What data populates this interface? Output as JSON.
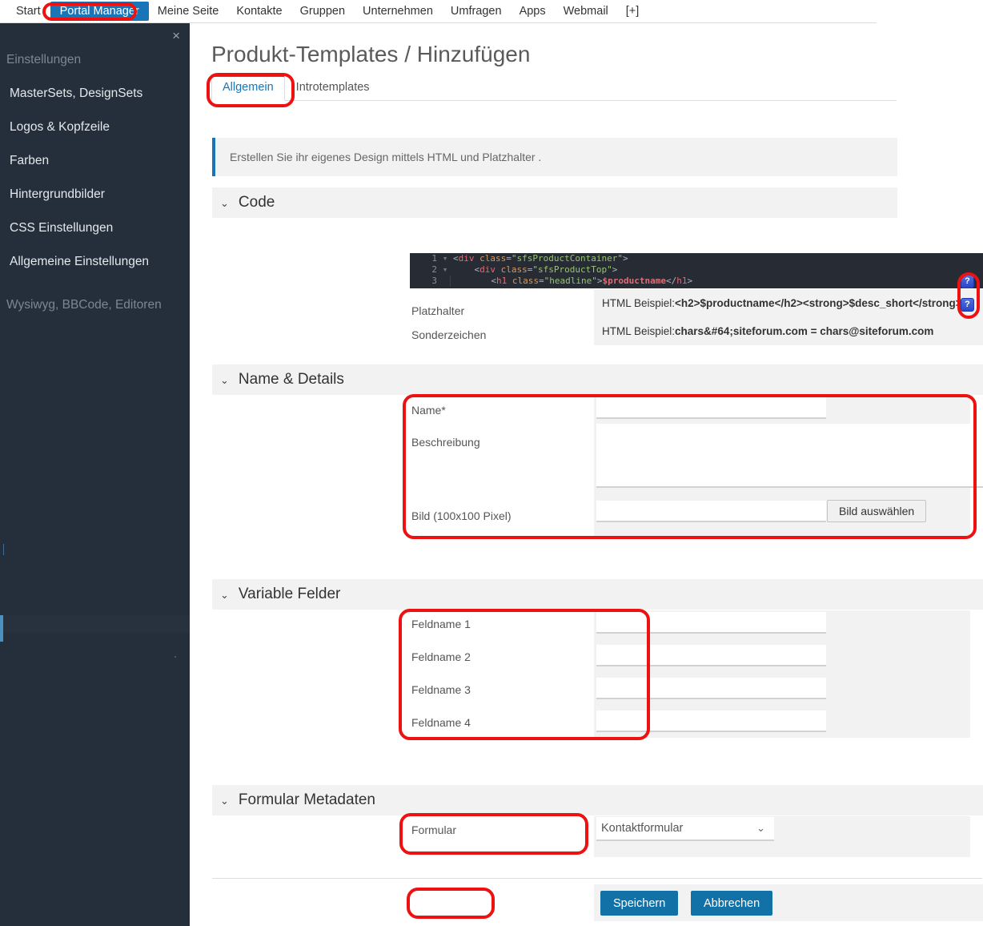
{
  "topnav": {
    "items": [
      {
        "label": "Start",
        "active": false
      },
      {
        "label": "Portal Manager",
        "active": true
      },
      {
        "label": "Meine Seite",
        "active": false
      },
      {
        "label": "Kontakte",
        "active": false
      },
      {
        "label": "Gruppen",
        "active": false
      },
      {
        "label": "Unternehmen",
        "active": false
      },
      {
        "label": "Umfragen",
        "active": false
      },
      {
        "label": "Apps",
        "active": false
      },
      {
        "label": "Webmail",
        "active": false
      },
      {
        "label": "[+]",
        "active": false
      }
    ],
    "active_bg": "#1876b8"
  },
  "sidebar": {
    "close_icon": "×",
    "group_title": "Einstellungen",
    "items": [
      {
        "label": "MasterSets, DesignSets"
      },
      {
        "label": "Logos & Kopfzeile"
      },
      {
        "label": "Farben"
      },
      {
        "label": "Hintergrundbilder"
      },
      {
        "label": "CSS Einstellungen"
      },
      {
        "label": "Allgemeine Einstellungen"
      }
    ],
    "group_title_2": "Wysiwyg, BBCode, Editoren",
    "bg": "#242f3b",
    "accent": "#4a90c2"
  },
  "page": {
    "title": "Produkt-Templates / Hinzufügen"
  },
  "tabs": [
    {
      "label": "Allgemein",
      "active": true
    },
    {
      "label": "Introtemplates",
      "active": false
    }
  ],
  "info_banner": {
    "text": "Erstellen Sie ihr eigenes Design mittels HTML und Platzhalter .",
    "accent": "#1876b8"
  },
  "sections": {
    "code": {
      "title": "Code",
      "chevron": "⌄"
    },
    "name_details": {
      "title": "Name & Details",
      "chevron": "⌄"
    },
    "variable_felder": {
      "title": "Variable Felder",
      "chevron": "⌄"
    },
    "formular_metadaten": {
      "title": "Formular Metadaten",
      "chevron": "⌄"
    }
  },
  "code_editor": {
    "lines": [
      {
        "number": "1",
        "fold": "▾",
        "text": "<div class=\"sfsProductContainer\">"
      },
      {
        "number": "2",
        "fold": "▾",
        "text": "    <div class=\"sfsProductTop\">"
      },
      {
        "number": "3",
        "fold": "",
        "text": "        <h1 class=\"headline\">$productname</h1>"
      }
    ]
  },
  "placeholders": {
    "rows": [
      {
        "label": "Platzhalter",
        "lead": "HTML Beispiel: ",
        "code": "<h2>$productname</h2><strong>$desc_short</strong>",
        "help_icon": "?"
      },
      {
        "label": "Sonderzeichen",
        "lead": "HTML Beispiel: ",
        "code": "chars&#64;siteforum.com = chars@siteforum.com",
        "help_icon": "?"
      }
    ]
  },
  "name_details": {
    "name": {
      "label": "Name*",
      "value": "",
      "placeholder": ""
    },
    "beschreibung": {
      "label": "Beschreibung",
      "value": "",
      "placeholder": ""
    },
    "bild": {
      "label": "Bild (100x100 Pixel)",
      "value": "",
      "placeholder": "",
      "button_label": "Bild auswählen"
    }
  },
  "variable_felder": {
    "fields": [
      {
        "label": "Feldname 1",
        "value": ""
      },
      {
        "label": "Feldname 2",
        "value": ""
      },
      {
        "label": "Feldname 3",
        "value": ""
      },
      {
        "label": "Feldname 4",
        "value": ""
      }
    ]
  },
  "formular_metadaten": {
    "label": "Formular",
    "selected": "Kontaktformular",
    "chevron": "⌄",
    "options": [
      "Kontaktformular"
    ]
  },
  "footer": {
    "save_label": "Speichern",
    "cancel_label": "Abbrechen",
    "primary_color": "#1272a8"
  },
  "annotations": {
    "color": "#ee1111"
  }
}
